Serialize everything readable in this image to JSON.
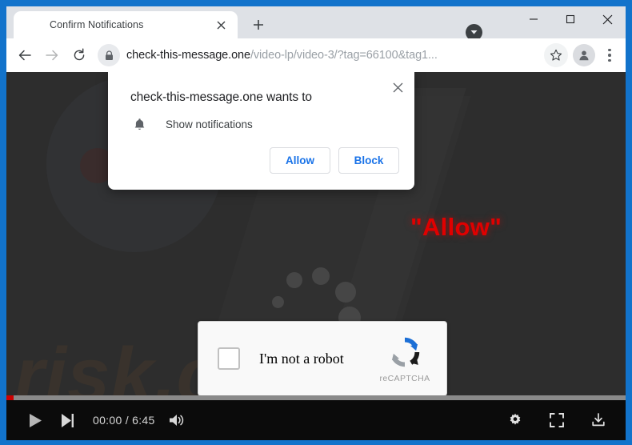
{
  "window": {
    "minimize_label": "minimize-icon",
    "maximize_label": "maximize-icon",
    "close_label": "close-icon",
    "update_chip_icon": "chevron-down-circle-icon"
  },
  "browser": {
    "tabs": [
      {
        "title": "Confirm Notifications",
        "close_icon": "close-icon"
      }
    ],
    "new_tab_icon": "plus-icon",
    "toolbar": {
      "back_icon": "back-arrow-icon",
      "forward_icon": "forward-arrow-icon",
      "reload_icon": "reload-icon",
      "lock_icon": "lock-icon",
      "url_host": "check-this-message.one",
      "url_path": "/video-lp/video-3/?tag=66100&tag1...",
      "url_full": "check-this-message.one/video-lp/video-3/?tag=66100&tag1...",
      "star_icon": "star-icon",
      "profile_icon": "profile-avatar-icon",
      "menu_icon": "three-dot-menu-icon"
    }
  },
  "permission_dialog": {
    "title": "check-this-message.one wants to",
    "permission_icon": "bell-icon",
    "permission_label": "Show notifications",
    "allow_label": "Allow",
    "block_label": "Block",
    "close_icon": "close-icon",
    "accent_color": "#1a73e8"
  },
  "page": {
    "allow_hint_text": "\"Allow\"",
    "allow_hint_color": "#e00000",
    "watermark_text": "risk.com",
    "recaptcha": {
      "label": "I'm not a robot",
      "brand": "reCAPTCHA",
      "checkbox_icon": "checkbox-unchecked-icon",
      "logo_icon": "recaptcha-logo-icon",
      "logo_color": "#1c6fd6"
    }
  },
  "video_player": {
    "play_icon": "play-icon",
    "next_icon": "next-track-icon",
    "current_time": "00:00",
    "duration": "6:45",
    "time_display": "00:00 / 6:45",
    "volume_icon": "volume-icon",
    "settings_icon": "gear-icon",
    "fullscreen_icon": "fullscreen-icon",
    "download_icon": "download-icon",
    "progress_percent": 1.2,
    "progress_color": "#cc0000"
  }
}
